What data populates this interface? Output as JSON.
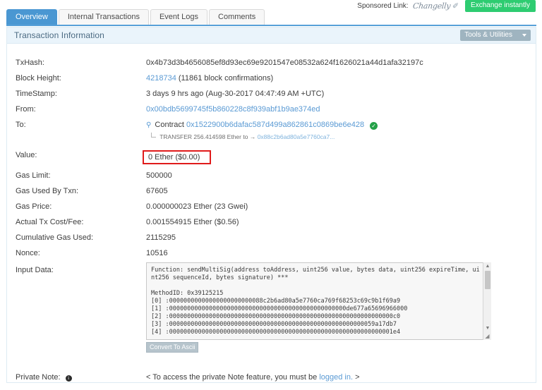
{
  "sponsor": {
    "label": "Sponsored Link:",
    "brand": "Changelly",
    "brand_mark": "✐",
    "button_label": "Exchange instantly",
    "button_color": "#2ecc71"
  },
  "tabs": [
    {
      "label": "Overview",
      "active": true
    },
    {
      "label": "Internal Transactions",
      "active": false
    },
    {
      "label": "Event Logs",
      "active": false
    },
    {
      "label": "Comments",
      "active": false
    }
  ],
  "panel": {
    "title": "Transaction Information",
    "tools_label": "Tools & Utilities",
    "accent_color": "#4a97d2",
    "header_bg": "#eaf4fb"
  },
  "rows": {
    "txhash": {
      "label": "TxHash:",
      "value": "0x4b73d3b4656085ef8d93ec69e9201547e08532a624f1626021a44d1afa32197c"
    },
    "block_height": {
      "label": "Block Height:",
      "number": "4218734",
      "confirmations": "(11861 block confirmations)"
    },
    "timestamp": {
      "label": "TimeStamp:",
      "value": "3 days 9 hrs ago (Aug-30-2017 04:47:49 AM +UTC)"
    },
    "from": {
      "label": "From:",
      "address": "0x00bdb5699745f5b860228c8f939abf1b9ae374ed"
    },
    "to": {
      "label": "To:",
      "prefix": "Contract",
      "address": "0x1522900b6dafac587d499a862861c0869be6e428",
      "verified_icon": "✓",
      "transfer_prefix": "TRANSFER",
      "transfer_amount": "256.414598 Ether",
      "transfer_to": "to →",
      "transfer_address": "0x88c2b6ad80a5e7760ca7..."
    },
    "value": {
      "label": "Value:",
      "value": "0 Ether ($0.00)",
      "highlight_color": "#e01b1b"
    },
    "gas_limit": {
      "label": "Gas Limit:",
      "value": "500000"
    },
    "gas_used": {
      "label": "Gas Used By Txn:",
      "value": "67605"
    },
    "gas_price": {
      "label": "Gas Price:",
      "value": "0.000000023 Ether (23 Gwei)"
    },
    "tx_cost": {
      "label": "Actual Tx Cost/Fee:",
      "value": "0.001554915 Ether ($0.56)"
    },
    "cumulative_gas": {
      "label": "Cumulative Gas Used:",
      "value": "2115295"
    },
    "nonce": {
      "label": "Nonce:",
      "value": "10516"
    },
    "input_data": {
      "label": "Input Data:",
      "content": "Function: sendMultiSig(address toAddress, uint256 value, bytes data, uint256 expireTime, uint256 sequenceId, bytes signature) ***\n\nMethodID: 0x39125215\n[0] :00000000000000000000000088c2b6ad80a5e7760ca769f68253c69c9b1f69a9\n[1] :0000000000000000000000000000000000000000000000000de677a65696966000\n[2] :00000000000000000000000000000000000000000000000000000000000000c0\n[3] :000000000000000000000000000000000000000000000000000000059a17db7\n[4] :00000000000000000000000000000000000000000000000000000000000001e4",
      "convert_button": "Convert To Ascii"
    },
    "private_note": {
      "label": "Private Note:",
      "info_icon": "i",
      "text_before": "< To access the private Note feature, you must be",
      "link_text": "logged in.",
      "text_after": ">"
    }
  }
}
